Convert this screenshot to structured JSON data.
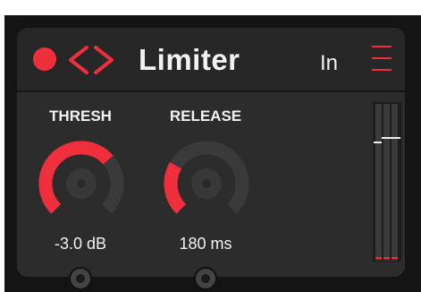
{
  "header": {
    "title": "Limiter",
    "bypass_label": "In"
  },
  "knobs": [
    {
      "label": "THRESH",
      "value_text": "-3.0 dB",
      "level": 0.68
    },
    {
      "label": "RELEASE",
      "value_text": "180 ms",
      "level": 0.28
    }
  ],
  "meters": {
    "input_peak": 0.76,
    "output_peak": 0.79
  },
  "colors": {
    "accent": "#ef2f3b",
    "panel": "#2c2c2c",
    "background": "#141414",
    "track": "#3a3a3a",
    "text": "#f2f2f2"
  }
}
